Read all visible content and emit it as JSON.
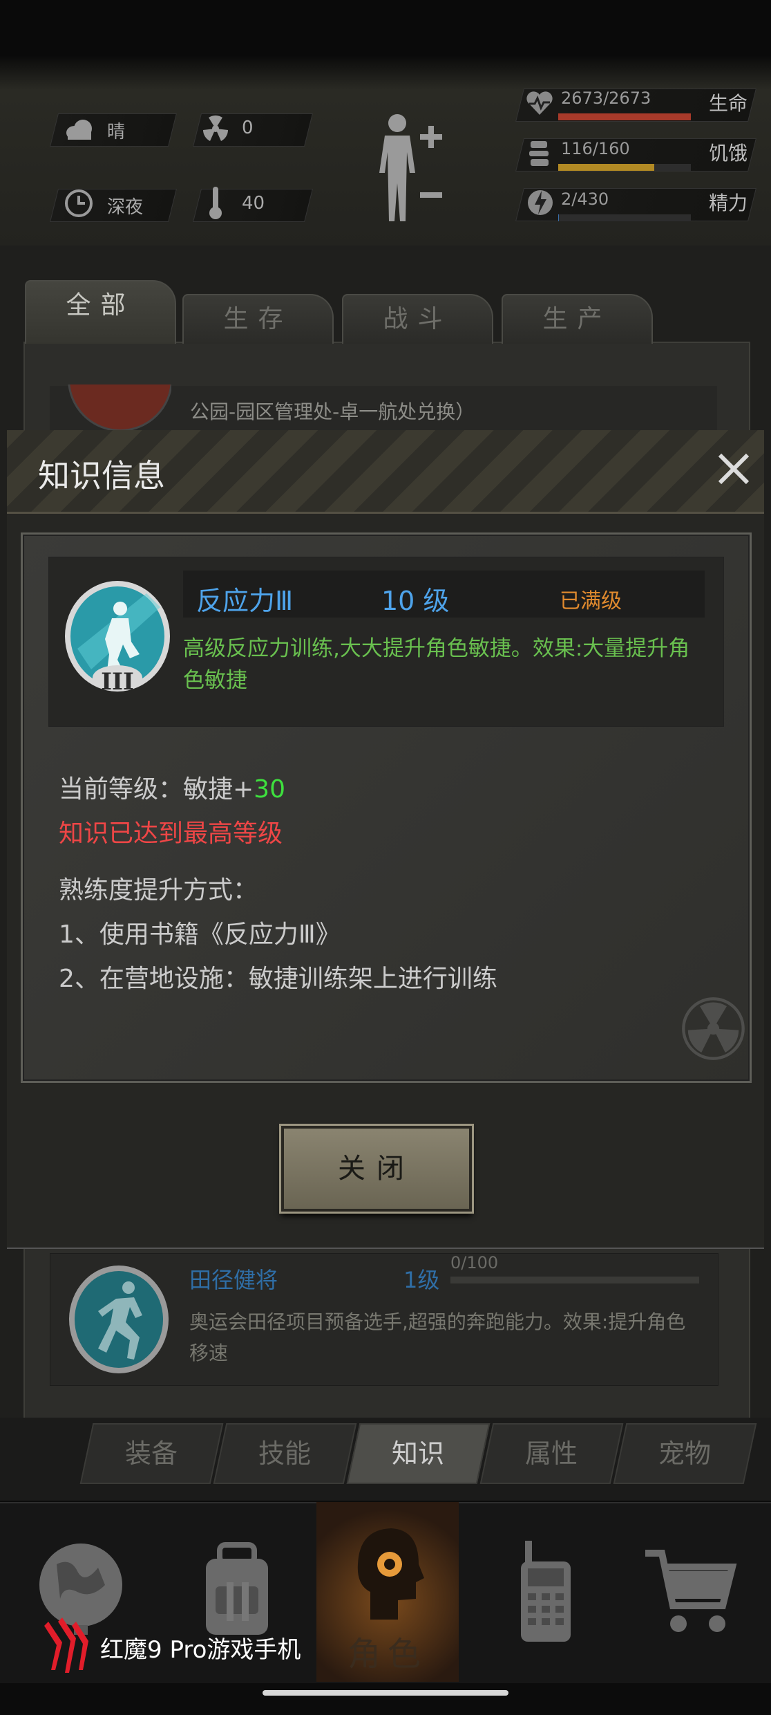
{
  "status": {
    "weather": "晴",
    "radiation": "0",
    "time_of_day": "深夜",
    "temperature": "40",
    "stats": [
      {
        "value": "2673/2673",
        "label": "生命",
        "fill": 1.0,
        "color": "#a83a2a"
      },
      {
        "value": "116/160",
        "label": "饥饿",
        "fill": 0.725,
        "color": "#b28a24"
      },
      {
        "value": "2/430",
        "label": "精力",
        "fill": 0.005,
        "color": "#3a6fa8"
      }
    ]
  },
  "tabs": [
    {
      "label": "全部",
      "active": true
    },
    {
      "label": "生存",
      "active": false
    },
    {
      "label": "战斗",
      "active": false
    },
    {
      "label": "生产",
      "active": false
    }
  ],
  "background_item_text": "公园-园区管理处-卓一航处兑换）",
  "modal": {
    "title": "知识信息",
    "skill": {
      "name": "反应力Ⅲ",
      "level": "10 级",
      "status": "已满级",
      "description_line1": "高级反应力训练,大大提升角色敏捷。效果:大量提升角",
      "description_line2": "色敏捷",
      "badge_numeral": "III"
    },
    "current_level_label": "当前等级：敏捷+",
    "current_level_value": "30",
    "max_level_notice": "知识已达到最高等级",
    "methods_title": "熟练度提升方式：",
    "method1": "1、使用书籍《反应力Ⅲ》",
    "method2": "2、在营地设施：敏捷训练架上进行训练",
    "close_label": "关闭"
  },
  "list_item": {
    "name": "田径健将",
    "level": "1级",
    "progress": "0/100",
    "description_line1": "奥运会田径项目预备选手,超强的奔跑能力。效果:提升角色",
    "description_line2": "移速"
  },
  "subnav": [
    {
      "label": "装备",
      "active": false
    },
    {
      "label": "技能",
      "active": false
    },
    {
      "label": "知识",
      "active": true
    },
    {
      "label": "属性",
      "active": false
    },
    {
      "label": "宠物",
      "active": false
    }
  ],
  "bottomnav": {
    "role_label": "角色",
    "brand_text": "红魔9 Pro游戏手机"
  }
}
